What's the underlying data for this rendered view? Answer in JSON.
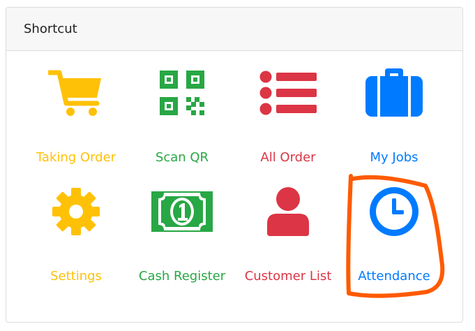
{
  "panel": {
    "title": "Shortcut"
  },
  "colors": {
    "yellow": "#FFC107",
    "green": "#28A745",
    "red": "#DC3545",
    "blue": "#007BFF",
    "annotation": "#FF5A00"
  },
  "shortcuts": [
    {
      "label": "Taking Order",
      "icon": "shopping-cart-icon",
      "color": "#FFC107"
    },
    {
      "label": "Scan QR",
      "icon": "qr-code-icon",
      "color": "#28A745"
    },
    {
      "label": "All Order",
      "icon": "list-icon",
      "color": "#DC3545"
    },
    {
      "label": "My Jobs",
      "icon": "briefcase-icon",
      "color": "#007BFF"
    },
    {
      "label": "Settings",
      "icon": "gear-icon",
      "color": "#FFC107"
    },
    {
      "label": "Cash Register",
      "icon": "money-bill-icon",
      "color": "#28A745"
    },
    {
      "label": "Customer List",
      "icon": "user-icon",
      "color": "#DC3545"
    },
    {
      "label": "Attendance",
      "icon": "clock-icon",
      "color": "#007BFF"
    }
  ]
}
